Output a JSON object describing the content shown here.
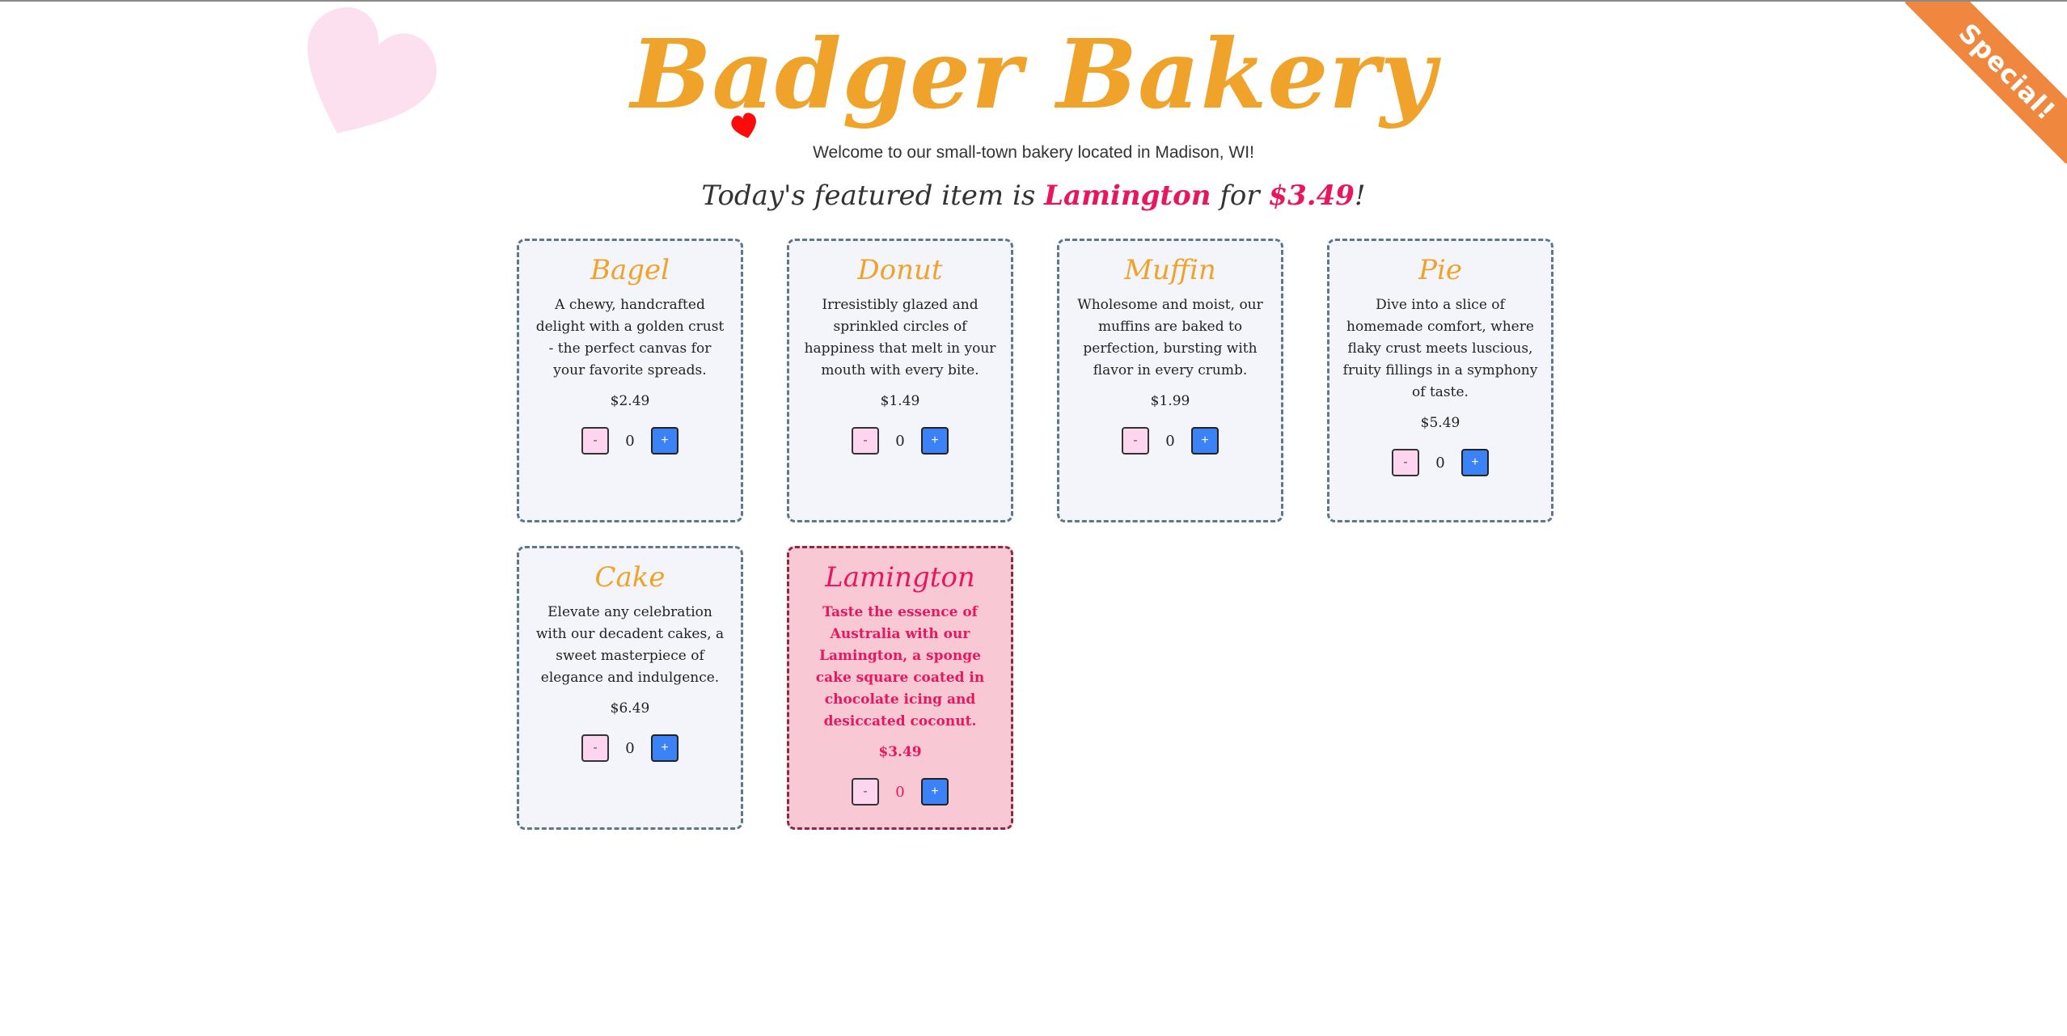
{
  "header": {
    "title": "Badger Bakery",
    "tagline": "Welcome to our small-town bakery located in Madison, WI!",
    "featured_prefix": "Today's featured item is ",
    "featured_item": "Lamington",
    "featured_middle": " for ",
    "featured_price": "$3.49",
    "featured_suffix": "!"
  },
  "ribbon": {
    "label": "Special!"
  },
  "colors": {
    "brand_orange": "#f0a32a",
    "accent_pink": "#e8165f",
    "ribbon_orange": "#f0873f",
    "plus_blue": "#3b82f6",
    "minus_pink": "#fdd5ef",
    "card_bg": "#f4f5fb",
    "special_card_bg": "#f9c8d5"
  },
  "products": [
    {
      "name": "Bagel",
      "description": "A chewy, handcrafted delight with a golden crust - the perfect canvas for your favorite spreads.",
      "price": "$2.49",
      "quantity": "0",
      "minus_label": "-",
      "plus_label": "+"
    },
    {
      "name": "Donut",
      "description": "Irresistibly glazed and sprinkled circles of happiness that melt in your mouth with every bite.",
      "price": "$1.49",
      "quantity": "0",
      "minus_label": "-",
      "plus_label": "+"
    },
    {
      "name": "Muffin",
      "description": "Wholesome and moist, our muffins are baked to perfection, bursting with flavor in every crumb.",
      "price": "$1.99",
      "quantity": "0",
      "minus_label": "-",
      "plus_label": "+"
    },
    {
      "name": "Pie",
      "description": "Dive into a slice of homemade comfort, where flaky crust meets luscious, fruity fillings in a symphony of taste.",
      "price": "$5.49",
      "quantity": "0",
      "minus_label": "-",
      "plus_label": "+"
    },
    {
      "name": "Cake",
      "description": "Elevate any celebration with our decadent cakes, a sweet masterpiece of elegance and indulgence.",
      "price": "$6.49",
      "quantity": "0",
      "minus_label": "-",
      "plus_label": "+"
    },
    {
      "name": "Lamington",
      "description": "Taste the essence of Australia with our Lamington, a sponge cake square coated in chocolate icing and desiccated coconut.",
      "price": "$3.49",
      "quantity": "0",
      "minus_label": "-",
      "plus_label": "+"
    }
  ]
}
